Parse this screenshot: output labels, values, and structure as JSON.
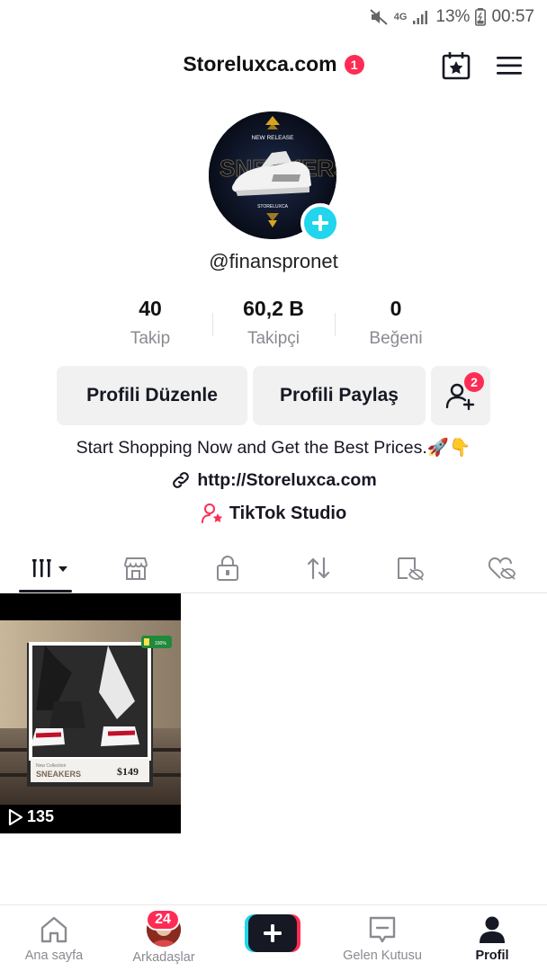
{
  "status_bar": {
    "network": "4G",
    "battery_percent": "13%",
    "time": "00:57"
  },
  "header": {
    "title": "Storeluxca.com",
    "notification_count": "1",
    "calendar_icon": "calendar-star-icon",
    "menu_icon": "hamburger-menu-icon"
  },
  "profile": {
    "username": "@finanspronet",
    "avatar_text_top": "NEW RELEASE",
    "avatar_text_mid": "STORELUXCA",
    "stats": [
      {
        "value": "40",
        "label": "Takip"
      },
      {
        "value": "60,2 B",
        "label": "Takipçi"
      },
      {
        "value": "0",
        "label": "Beğeni"
      }
    ],
    "buttons": {
      "edit": "Profili Düzenle",
      "share": "Profili Paylaş",
      "friends_badge": "2"
    },
    "bio": "Start Shopping Now and Get the Best Prices.🚀👇",
    "link": "http://Storeluxca.com",
    "studio": "TikTok Studio"
  },
  "tabs": [
    "videos-grid-icon",
    "shop-icon",
    "lock-icon",
    "repost-icon",
    "hidden-tag-icon",
    "liked-hidden-icon"
  ],
  "videos": [
    {
      "views": "135",
      "card_small": "New Collection",
      "card_title": "SNEAKERS",
      "card_price": "$149",
      "tag": "100%"
    }
  ],
  "bottom_nav": {
    "home": "Ana sayfa",
    "friends": "Arkadaşlar",
    "friends_badge": "24",
    "inbox": "Gelen Kutusu",
    "profile": "Profil"
  },
  "colors": {
    "accent": "#fe2c55",
    "cyan": "#20d5ec",
    "text": "#161823",
    "muted": "#8a8b91"
  }
}
